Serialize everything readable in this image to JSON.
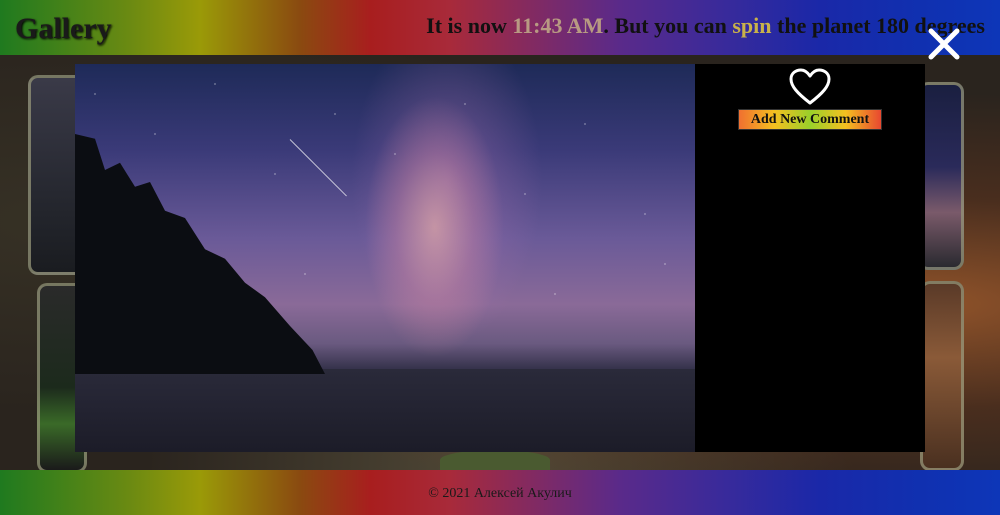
{
  "header": {
    "title": "Gallery",
    "banner_prefix": "It is now ",
    "banner_time": "11:43 AM",
    "banner_middle": ". But you can ",
    "banner_link": "spin",
    "banner_suffix": " the planet 180 degrees"
  },
  "modal": {
    "like_icon": "heart-outline-icon",
    "add_comment_label": "Add New Comment",
    "close_icon": "close-x-icon"
  },
  "footer": {
    "copyright": "© 2021 Алексей Акулич"
  },
  "colors": {
    "clock_text": "#b89a82",
    "spin_link": "#c9b14a",
    "modal_panel": "#000000"
  }
}
